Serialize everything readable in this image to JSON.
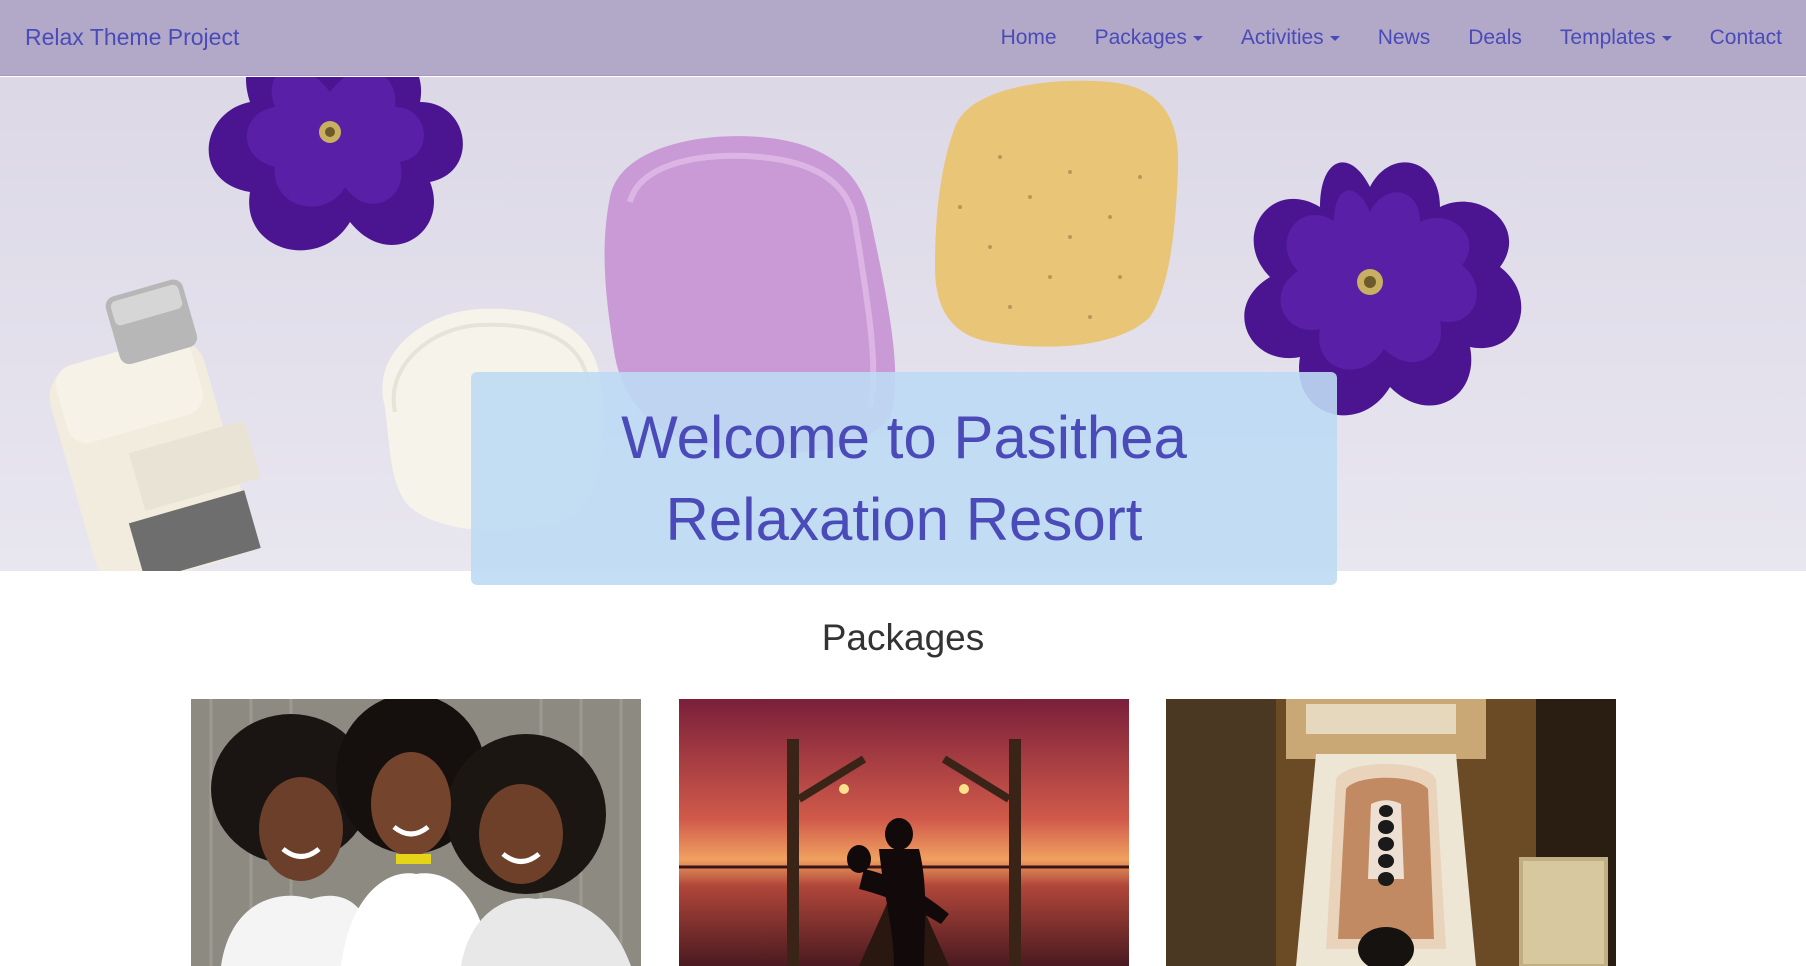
{
  "navbar": {
    "brand": "Relax Theme Project",
    "items": [
      {
        "label": "Home",
        "dropdown": false
      },
      {
        "label": "Packages",
        "dropdown": true
      },
      {
        "label": "Activities",
        "dropdown": true
      },
      {
        "label": "News",
        "dropdown": false
      },
      {
        "label": "Deals",
        "dropdown": false
      },
      {
        "label": "Templates",
        "dropdown": true
      },
      {
        "label": "Contact",
        "dropdown": false
      }
    ]
  },
  "hero": {
    "welcome_line1": "Welcome to Pasithea",
    "welcome_line2": "Relaxation Resort"
  },
  "packages": {
    "title": "Packages",
    "cards": [
      {
        "image": "three-women-photo"
      },
      {
        "image": "sunset-couple-pier-photo"
      },
      {
        "image": "hot-stone-massage-photo"
      }
    ]
  },
  "colors": {
    "navbar_bg": "#b2a9c8",
    "link": "#4a4bb8",
    "welcome_box": "#bedaf4",
    "heading": "#333333"
  }
}
